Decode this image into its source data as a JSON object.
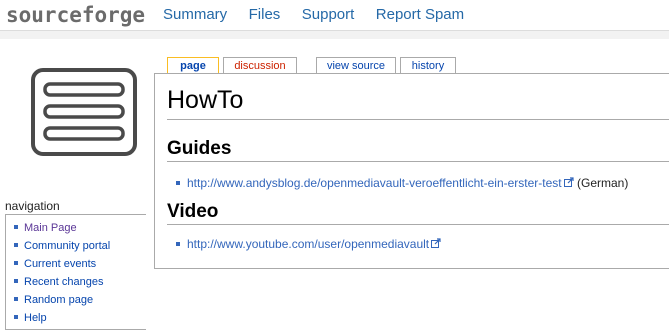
{
  "header": {
    "logo_text": "sourceforge",
    "nav": [
      "Summary",
      "Files",
      "Support",
      "Report Spam"
    ]
  },
  "sidebar": {
    "logo_icon": "document-lines-icon",
    "navigation_title": "navigation",
    "items": [
      "Main Page",
      "Community portal",
      "Current events",
      "Recent changes",
      "Random page",
      "Help"
    ]
  },
  "tabs": [
    "page",
    "discussion",
    "view source",
    "history"
  ],
  "content": {
    "title": "HowTo",
    "sections": [
      {
        "heading": "Guides",
        "link_text": "http://www.andysblog.de/openmediavault-veroeffentlicht-ein-erster-test",
        "suffix": " (German)"
      },
      {
        "heading": "Video",
        "link_text": "http://www.youtube.com/user/openmediavault",
        "suffix": ""
      }
    ]
  },
  "colors": {
    "link": "#3366bb",
    "top_nav": "#2569a7",
    "new_link": "#cc2200",
    "selected_tab_border": "#fabd23"
  }
}
